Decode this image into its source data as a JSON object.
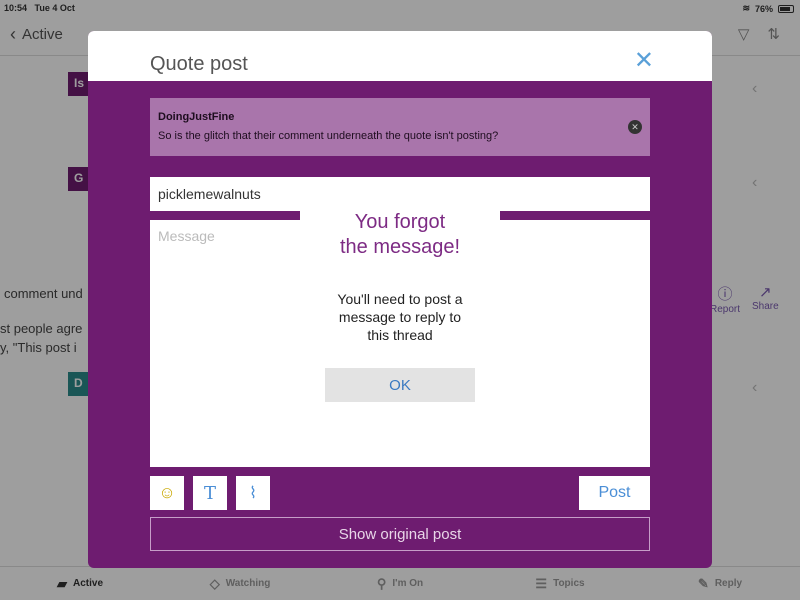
{
  "status_bar": {
    "time": "10:54",
    "date": "Tue 4 Oct",
    "battery": "76%"
  },
  "nav": {
    "back_label": "Active"
  },
  "background": {
    "badge_letters": [
      "Is",
      "G",
      "D"
    ],
    "snippets": [
      "comment und",
      "st people agre",
      "y, \"This post i"
    ],
    "report_label": "Report",
    "share_label": "Share"
  },
  "colors": {
    "sheet": "#6e1c70",
    "quote_box": "#a975ab",
    "accent_blue": "#4a8ed6",
    "alert_title": "#7d2b84"
  },
  "quote_post": {
    "title": "Quote post",
    "quote": {
      "author": "DoingJustFine",
      "text": "So is the glitch that their comment underneath the quote isn't posting?"
    },
    "name_value": "picklemewalnuts",
    "message_placeholder": "Message",
    "post_label": "Post",
    "show_original_label": "Show original post"
  },
  "alert": {
    "title": "You forgot\nthe message!",
    "body": "You'll need to post a\nmessage to reply to\nthis thread",
    "ok_label": "OK"
  },
  "tabs": [
    {
      "label": "Active",
      "icon": "chat-bubble-icon"
    },
    {
      "label": "Watching",
      "icon": "eye-icon"
    },
    {
      "label": "I'm On",
      "icon": "pin-icon"
    },
    {
      "label": "Topics",
      "icon": "list-icon"
    },
    {
      "label": "Reply",
      "icon": "pencil-icon"
    }
  ]
}
